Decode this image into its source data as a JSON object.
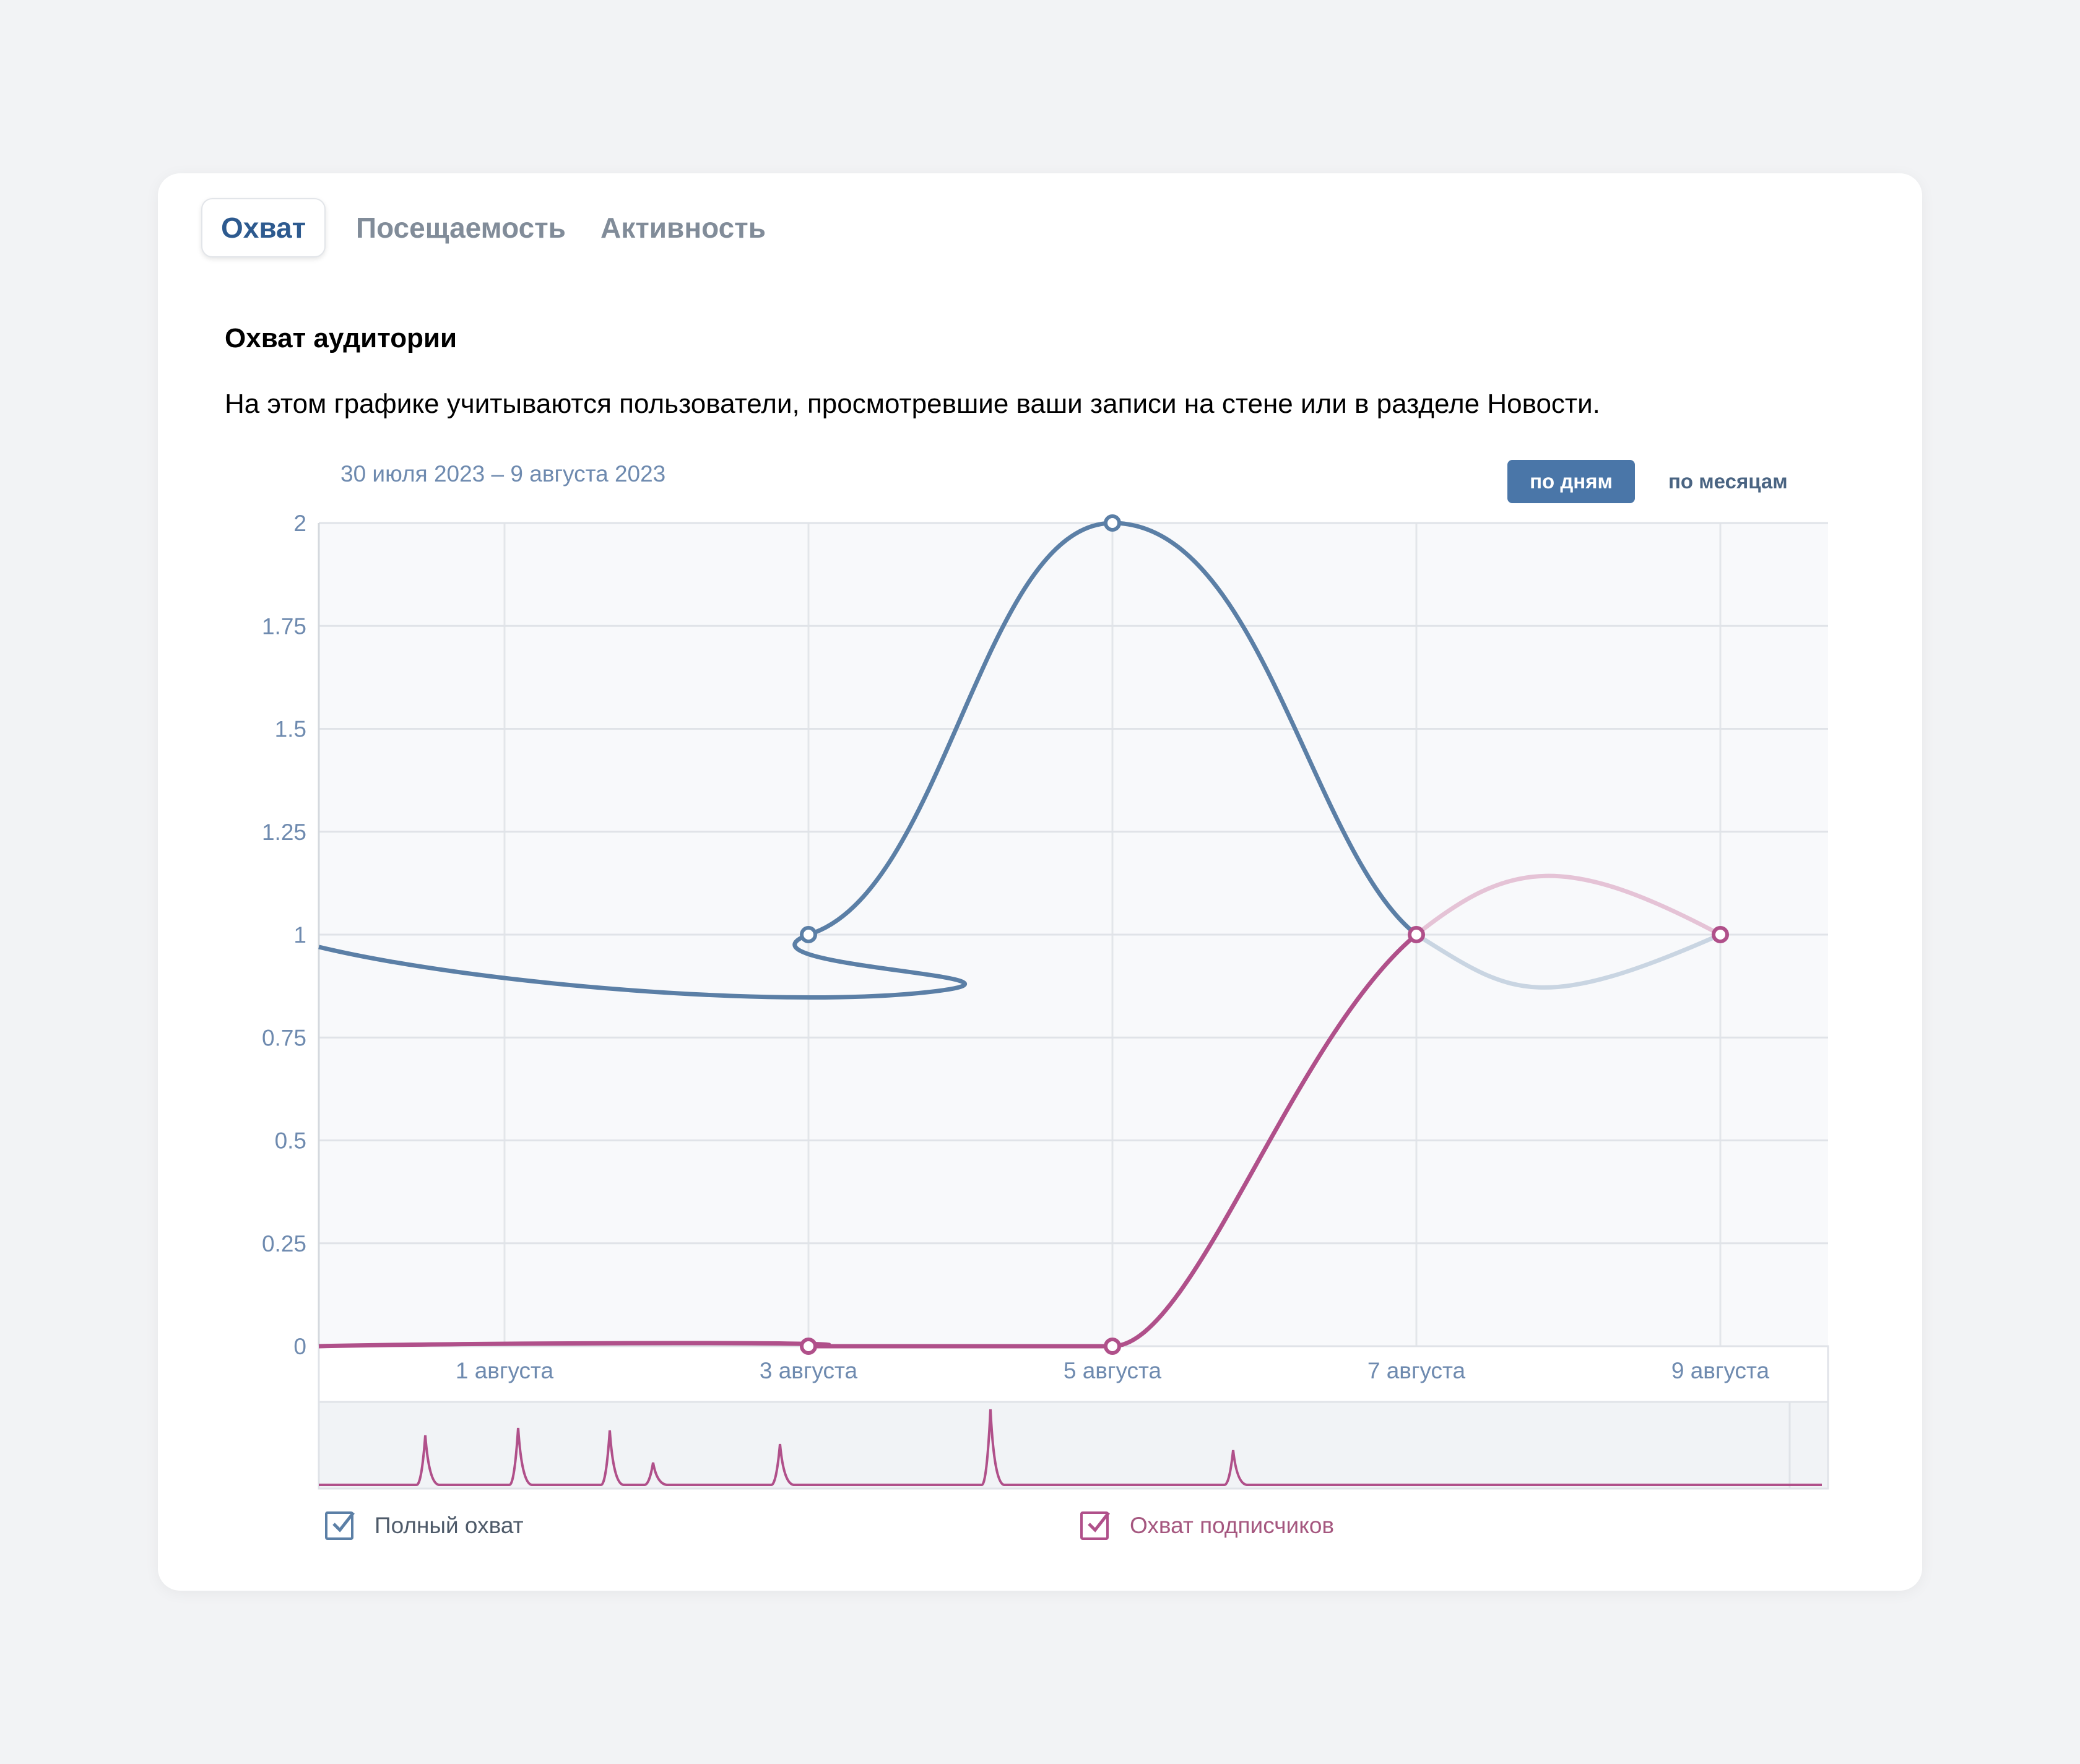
{
  "tabs": [
    {
      "label": "Охват",
      "active": true
    },
    {
      "label": "Посещаемость",
      "active": false
    },
    {
      "label": "Активность",
      "active": false
    }
  ],
  "section": {
    "title": "Охват аудитории",
    "description": "На этом графике учитываются пользователи, просмотревшие ваши записи на стене или в разделе Новости."
  },
  "period": {
    "date_range": "30 июля 2023 – 9 августа 2023",
    "by_days_label": "по дням",
    "by_months_label": "по месяцам",
    "selected": "по дням"
  },
  "legend": {
    "full_reach": {
      "label": "Полный охват",
      "checked": true,
      "color": "#5b7fa6"
    },
    "subscribers_reach": {
      "label": "Охват подписчиков",
      "checked": true,
      "color": "#b0508a"
    }
  },
  "chart_data": {
    "type": "line",
    "x_tick_labels": [
      "1 августа",
      "3 августа",
      "5 августа",
      "7 августа",
      "9 августа"
    ],
    "y_ticks": [
      "0",
      "0.25",
      "0.5",
      "0.75",
      "1",
      "1.25",
      "1.5",
      "1.75",
      "2"
    ],
    "ylim": [
      0,
      2
    ],
    "grid": true,
    "series": [
      {
        "name": "Полный охват",
        "color": "#5b7fa6",
        "points": [
          {
            "x": "3 августа",
            "y": 1
          },
          {
            "x": "5 августа",
            "y": 2
          },
          {
            "x": "7 августа",
            "y": 1
          },
          {
            "x": "9 августа",
            "y": 1
          }
        ]
      },
      {
        "name": "Охват подписчиков",
        "color": "#b0508a",
        "points": [
          {
            "x": "3 августа",
            "y": 0
          },
          {
            "x": "5 августа",
            "y": 0
          },
          {
            "x": "7 августа",
            "y": 1
          },
          {
            "x": "9 августа",
            "y": 1
          }
        ]
      }
    ]
  }
}
